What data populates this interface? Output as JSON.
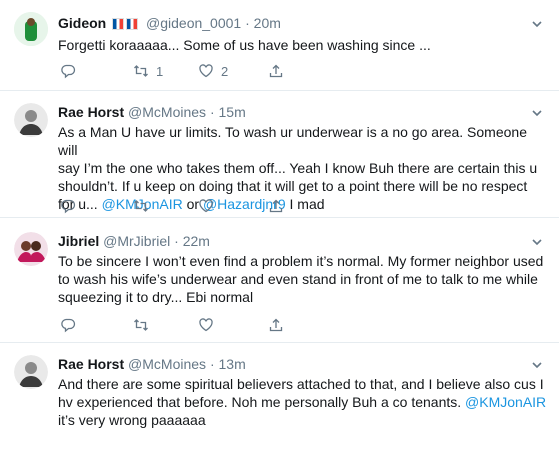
{
  "tweets": [
    {
      "name": "Gideon",
      "handle": "@gideon_0001",
      "dot": "·",
      "time": "20m",
      "line1": "Forgetti koraaaaa... Some of us have been washing since ...",
      "replies": "",
      "retweets": "1",
      "likes": "2"
    },
    {
      "name": "Rae Horst",
      "handle": "@McMoines",
      "dot": "·",
      "time": "15m",
      "line1": "As a Man U have ur limits. To wash ur underwear is a no go area. Someone will",
      "line2": "say I’m the one who takes them off... Yeah I know Buh there are certain this u",
      "line3": "shouldn’t. If u keep on doing  that it will get to a point there will be no respect",
      "line4_pre": "for u... ",
      "mention1": "@KMJonAIR",
      "line4_mid": " or ",
      "mention2": "@Hazardjnr9",
      "line4_post": " I mad",
      "replies": "",
      "retweets": "",
      "likes": ""
    },
    {
      "name": "Jibriel",
      "handle": "@MrJibriel",
      "dot": "·",
      "time": "22m",
      "line1": "To be sincere I won’t even find a problem it’s normal. My former neighbor used",
      "line2": "to wash his wife’s underwear and even stand in front of me to talk to me while",
      "line3": "squeezing it to dry... Ebi normal",
      "replies": "",
      "retweets": "",
      "likes": ""
    },
    {
      "name": "Rae Horst",
      "handle": "@McMoines",
      "dot": "·",
      "time": "13m",
      "line1": "And there are some spiritual believers attached to that, and I believe also cus I",
      "line2_pre": "hv experienced that before. Noh me personally Buh a co tenants. ",
      "mention1": "@KMJonAIR",
      "line3": "it’s very wrong paaaaaa",
      "replies": "",
      "retweets": "",
      "likes": ""
    }
  ],
  "icons": {
    "reply": "reply-icon",
    "retweet": "retweet-icon",
    "like": "heart-icon",
    "share": "share-icon",
    "menu": "chevron-down-icon"
  },
  "colors": {
    "text": "#14171a",
    "muted": "#657786",
    "link": "#1b95e0",
    "divider": "#e6ecf0",
    "flag_blue": "#0055a4",
    "flag_red": "#ef4135"
  }
}
